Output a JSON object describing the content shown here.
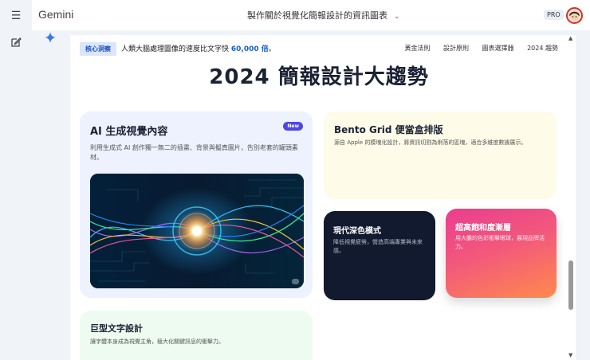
{
  "app": {
    "brand": "Gemini",
    "chat_title": "製作關於視覺化簡報設計的資訊圖表",
    "plan": "PRO"
  },
  "canvas": {
    "badge": "核心洞察",
    "insight_prefix": "人類大腦處理圖像的速度比文字快 ",
    "insight_highlight": "60,000 倍",
    "insight_suffix": "。",
    "nav_links": [
      "黃金法則",
      "設計原則",
      "圖表選擇器",
      "2024 趨勢"
    ],
    "headline": "2024 簡報設計大趨勢",
    "cards": {
      "ai": {
        "title": "AI 生成視覺內容",
        "tag": "New",
        "desc": "利用生成式 AI 創作獨一無二的插畫、背景與擬真圖片，告別老套的罐頭素材。"
      },
      "bento": {
        "title": "Bento Grid 便當盒排版",
        "desc": "源自 Apple 的模塊化設計，將資訊切割為俐落的區塊，適合多維度數據展示。"
      },
      "dark": {
        "title": "現代深色模式",
        "desc": "降低視覺疲勞，營造高端專業與未來感。"
      },
      "gradient": {
        "title": "超高飽和度漸層",
        "desc": "用大膽的色彩衝擊眼球，展現品牌活力。"
      },
      "type": {
        "title": "巨型文字設計",
        "desc": "讓字體本身成為視覺主角，極大化關鍵訊息的衝擊力。"
      }
    }
  },
  "colors": {
    "accent": "#1a5fd0",
    "badge_bg": "#dbe6fb",
    "new_tag": "#4f46e5",
    "dark_card": "#111a2e"
  }
}
